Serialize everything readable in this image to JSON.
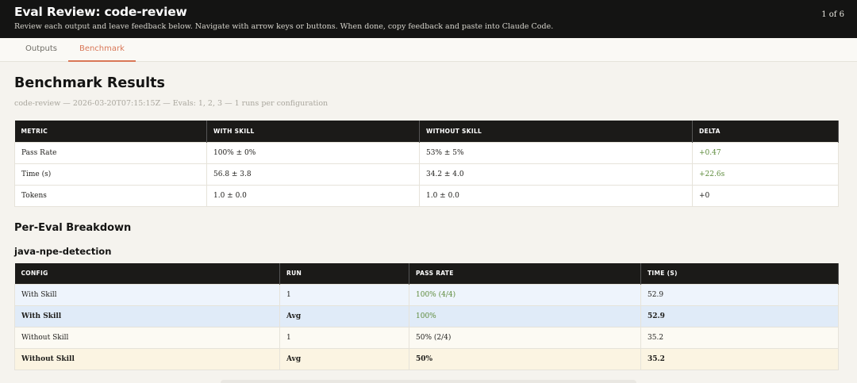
{
  "header": {
    "title": "Eval Review: code-review",
    "subtitle": "Review each output and leave feedback below. Navigate with arrow keys or buttons. When done, copy feedback and paste into Claude Code.",
    "counter": "1 of 6"
  },
  "tabs": [
    {
      "label": "Outputs",
      "active": false
    },
    {
      "label": "Benchmark",
      "active": true
    }
  ],
  "benchmark": {
    "title": "Benchmark Results",
    "meta": "code-review — 2026-03-20T07:15:15Z — Evals: 1, 2, 3 — 1 runs per configuration",
    "headers": [
      "METRIC",
      "WITH SKILL",
      "WITHOUT SKILL",
      "DELTA"
    ],
    "rows": [
      {
        "metric": "Pass Rate",
        "with_skill": "100% ± 0%",
        "without_skill": "53% ± 5%",
        "delta": "+0.47"
      },
      {
        "metric": "Time (s)",
        "with_skill": "56.8 ± 3.8",
        "without_skill": "34.2 ± 4.0",
        "delta": "+22.6s"
      },
      {
        "metric": "Tokens",
        "with_skill": "1.0 ± 0.0",
        "without_skill": "1.0 ± 0.0",
        "delta": "+0"
      }
    ]
  },
  "breakdown": {
    "title": "Per-Eval Breakdown",
    "eval_name": "java-npe-detection",
    "headers": [
      "CONFIG",
      "RUN",
      "PASS RATE",
      "TIME (S)"
    ],
    "rows": [
      {
        "config": "With Skill",
        "run": "1",
        "pass_rate": "100% (4/4)",
        "time": "52.9"
      },
      {
        "config": "With Skill",
        "run": "Avg",
        "pass_rate": "100%",
        "time": "52.9"
      },
      {
        "config": "Without Skill",
        "run": "1",
        "pass_rate": "50% (2/4)",
        "time": "35.2"
      },
      {
        "config": "Without Skill",
        "run": "Avg",
        "pass_rate": "50%",
        "time": "35.2"
      }
    ]
  },
  "colors": {
    "accent": "#d97757",
    "positive": "#5c8a3a",
    "header_bg": "#141413"
  }
}
